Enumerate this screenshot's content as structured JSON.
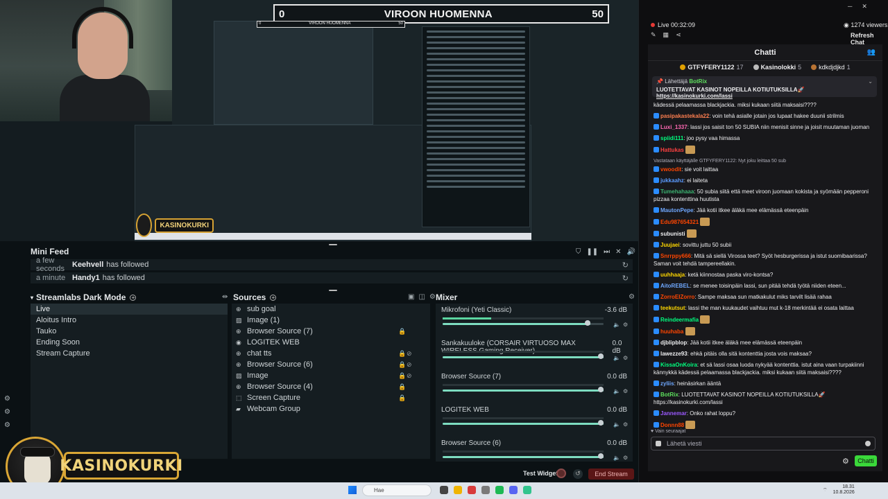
{
  "scoreboard": {
    "left": "0",
    "title": "VIROON HUOMENNA",
    "right": "50"
  },
  "mini_scoreboard": {
    "left": "0",
    "title": "VIROON HUOMENNA",
    "right": "50"
  },
  "logo": {
    "text": "KASINOKURKI"
  },
  "mini_feed": {
    "title": "Mini Feed",
    "rows": [
      {
        "ago": "a few seconds",
        "user": "Keehvell",
        "action": "has followed"
      },
      {
        "ago": "a minute",
        "user": "Handy1",
        "action": "has followed"
      }
    ]
  },
  "scenes": {
    "title": "Streamlabs Dark Mode",
    "items": [
      "Live",
      "Aloitus Intro",
      "Tauko",
      "Ending Soon",
      "Stream Capture"
    ]
  },
  "sources": {
    "title": "Sources",
    "items": [
      {
        "label": "sub goal",
        "icon": "globe-icon"
      },
      {
        "label": "Image (1)",
        "icon": "image-icon"
      },
      {
        "label": "Browser Source (7)",
        "icon": "globe-icon"
      },
      {
        "label": "LOGITEK WEB",
        "icon": "camera-icon"
      },
      {
        "label": "chat tts",
        "icon": "globe-icon"
      },
      {
        "label": "Browser Source (6)",
        "icon": "globe-icon"
      },
      {
        "label": "Image",
        "icon": "image-icon"
      },
      {
        "label": "Browser Source (4)",
        "icon": "globe-icon"
      },
      {
        "label": "Screen Capture",
        "icon": "screen-icon"
      },
      {
        "label": "Webcam Group",
        "icon": "folder-icon"
      }
    ]
  },
  "mixer": {
    "title": "Mixer",
    "channels": [
      {
        "name": "Mikrofoni (Yeti Classic)",
        "db": "-3.6 dB",
        "level": 0.92,
        "meter": 0.3
      },
      {
        "name": "Sankakuuloke (CORSAIR VIRTUOSO MAX WIRELESS Gaming Receiver)",
        "db": "0.0 dB",
        "level": 1.0,
        "meter": 0.0
      },
      {
        "name": "Browser Source (7)",
        "db": "0.0 dB",
        "level": 1.0,
        "meter": 0.0
      },
      {
        "name": "LOGITEK WEB",
        "db": "0.0 dB",
        "level": 1.0,
        "meter": 0.0
      },
      {
        "name": "Browser Source (6)",
        "db": "0.0 dB",
        "level": 1.0,
        "meter": 0.0
      }
    ]
  },
  "footer": {
    "test_widgets": "Test Widgets",
    "end_stream": "End Stream"
  },
  "stream": {
    "live": "Live 00:32:09",
    "viewers": "1274 viewers",
    "refresh": "Refresh Chat"
  },
  "chat": {
    "title": "Chatti",
    "leaderboard": [
      {
        "name": "GTFYFERY1122",
        "count": "17"
      },
      {
        "name": "Kasinolokki",
        "count": "5"
      },
      {
        "name": "kdkdjdjkd",
        "count": "1"
      }
    ],
    "pinned": {
      "line1_prefix": "Lähettäjä",
      "line1_user": "BotRix",
      "text": "LUOTETTAVAT KASINOT NOPEILLA KOTIUTUKSILLA🚀",
      "link": "https://kasinokurki.com/lassi"
    },
    "messages": [
      {
        "user": "",
        "color": "#efeff1",
        "text": "kädessä pelaamassa blackjackia. miksi kukaan siitä maksaisi????"
      },
      {
        "user": "pasipakastekala22",
        "color": "#ff7f50",
        "text": "voin tehä asialle jotain jos lupaat hakee duunii strilmis"
      },
      {
        "user": "Luxi_1337",
        "color": "#ff69b4",
        "text": "lassi jos saisit ton 50 SUBIA niin menisit sinne ja joisit muutaman juoman"
      },
      {
        "user": "spiidi111",
        "color": "#00ff7f",
        "text": "joo pysy vaa himassa"
      },
      {
        "user": "Hattukas",
        "color": "#ff4040",
        "text": ""
      },
      {
        "user": "",
        "reply": "Vastataan käyttäjälle GTFYFERY1122: Nyt joku leittaa 50 sub",
        "color": "#adadb8",
        "text": ""
      },
      {
        "user": "vwoodit",
        "color": "#ff4500",
        "text": "sie voit laittaa"
      },
      {
        "user": "jukkaahz",
        "color": "#5b9bff",
        "text": "ei laiteta"
      },
      {
        "user": "Tumehahaaa",
        "color": "#3cb371",
        "text": "50 subia siitä että meet viroon juomaan kokista ja syömään pepperoni pizzaa kontenttina huutista"
      },
      {
        "user": "MautonPepe",
        "color": "#6fa8ff",
        "text": "Jää kotii itkee äläkä mee elämässä eteenpäin"
      },
      {
        "user": "Edu987654321",
        "color": "#ff4500",
        "text": ""
      },
      {
        "user": "subunisti",
        "color": "#efeff1",
        "text": ""
      },
      {
        "user": "Juujaei",
        "color": "#ffd700",
        "text": "sovittu juttu 50 subii"
      },
      {
        "user": "Snrrppy666",
        "color": "#ff4500",
        "text": "Mitä sä siellä Virossa teet? Syöt hesburgerissa ja istut suomibaarissa? Saman voit tehdä tampereellakin."
      },
      {
        "user": "uuhhaaja",
        "color": "#ffd700",
        "text": "ketä kiinnostaa paska viro-kontsa?"
      },
      {
        "user": "AitoREBEL",
        "color": "#6fa8ff",
        "text": "se menee toisinpäin lassi, sun pitää tehdä työtä niiden eteen..."
      },
      {
        "user": "ZorroEIZorro",
        "color": "#ff4500",
        "text": "Sampe maksaa sun matkakulut miks tarvilt lisää rahaa"
      },
      {
        "user": "teekutsut",
        "color": "#ffd700",
        "text": "lassi the man kuukaudet vaihtuu mut k-18 merkintää ei osata laittaa"
      },
      {
        "user": "Reindeermafia",
        "color": "#00ff7f",
        "text": ""
      },
      {
        "user": "huuhaba",
        "color": "#ff4500",
        "text": ""
      },
      {
        "user": "djblipblop",
        "color": "#efeff1",
        "text": "Jää kotii itkee äläkä mee elämässä eteenpäin"
      },
      {
        "user": "lawezze93",
        "color": "#efeff1",
        "text": "ehkä pitäis olla sitä kontenttia josta vois maksaa?"
      },
      {
        "user": "KissaOnKoira",
        "color": "#00ff7f",
        "text": "et sä lassi osaa luoda nykyää kontenttia. istut aina vaan turpakiinni kännykkä kädessä pelaamassa blackjackia. miksi kukaan siitä maksaisi????"
      },
      {
        "user": "zyliis",
        "color": "#6fa8ff",
        "text": "heinäsirkan ääntä"
      },
      {
        "user": "BotRix",
        "color": "#5ee05e",
        "text": "LUOTETTAVAT KASINOT NOPEILLA KOTIUTUKSILLA🚀 https://kasinokurki.com/lassi"
      },
      {
        "user": "Jannemar",
        "color": "#9b59ff",
        "text": "Onko rahat loppu?"
      },
      {
        "user": "Donnn88",
        "color": "#ff4500",
        "text": ""
      }
    ],
    "followers_only": "Vain seuraajat",
    "input_placeholder": "Lähetä viesti",
    "send": "Chatti"
  },
  "taskbar": {
    "search": "Hae",
    "time": "18.31",
    "date": "10.8.2026"
  }
}
